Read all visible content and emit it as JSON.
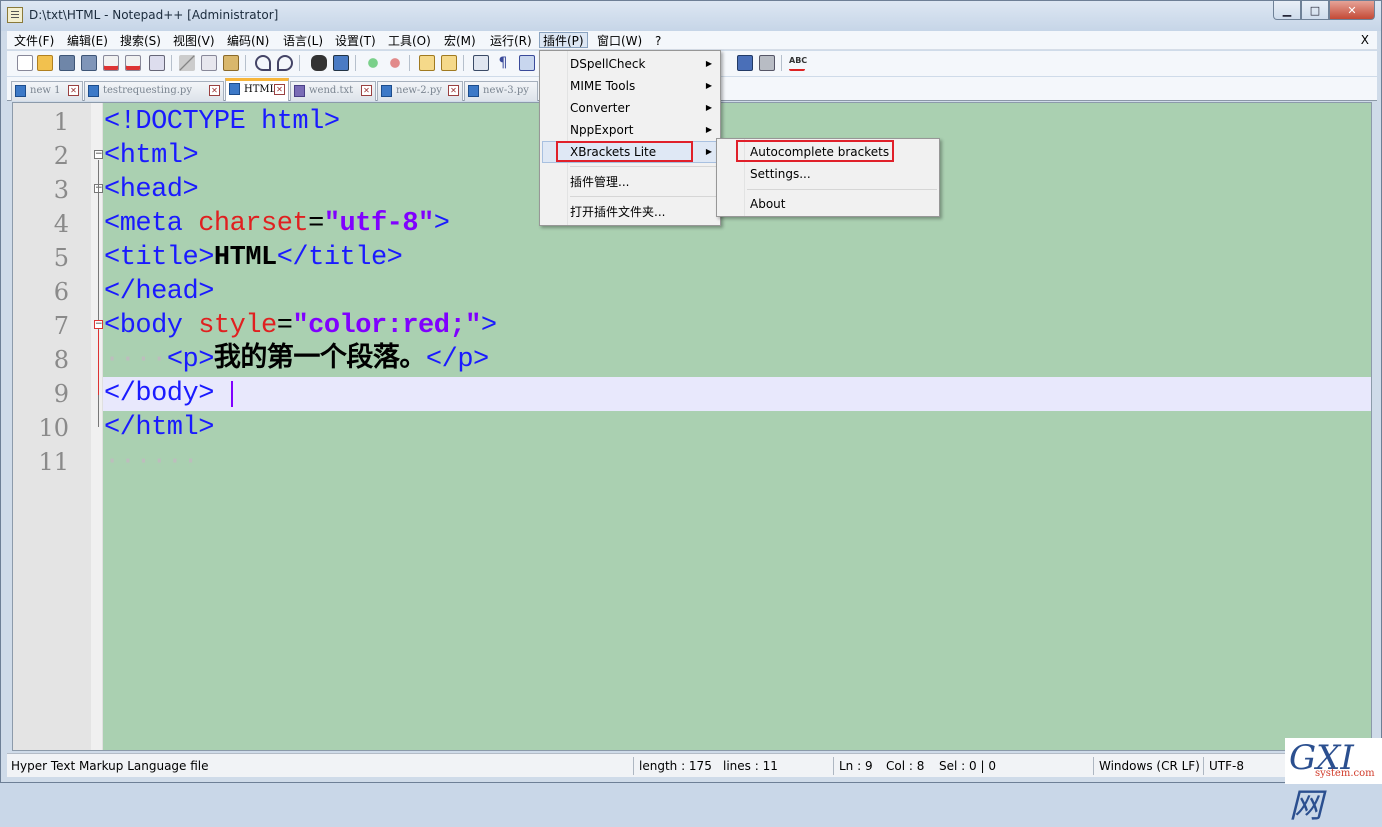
{
  "title": "D:\\txt\\HTML - Notepad++ [Administrator]",
  "menu": [
    "文件(F)",
    "编辑(E)",
    "搜索(S)",
    "视图(V)",
    "编码(N)",
    "语言(L)",
    "设置(T)",
    "工具(O)",
    "宏(M)",
    "运行(R)",
    "插件(P)",
    "窗口(W)",
    "?"
  ],
  "menu_close": "X",
  "tabs": [
    "new 1",
    "testrequesting.py",
    "HTML",
    "wend.txt",
    "new-2.py",
    "new-3.py"
  ],
  "lines": [
    {
      "n": "1",
      "parts": [
        [
          "tag",
          "<!DOCTYPE html>"
        ]
      ]
    },
    {
      "n": "2",
      "parts": [
        [
          "tag",
          "<html>"
        ]
      ]
    },
    {
      "n": "3",
      "parts": [
        [
          "tag",
          "<head>"
        ]
      ]
    },
    {
      "n": "4",
      "parts": [
        [
          "tag",
          "<meta "
        ],
        [
          "attr",
          "charset"
        ],
        [
          "plain",
          "="
        ],
        [
          "val",
          "\"utf-8\""
        ],
        [
          "tag",
          ">"
        ]
      ]
    },
    {
      "n": "5",
      "parts": [
        [
          "tag",
          "<title>"
        ],
        [
          "txt",
          "HTML"
        ],
        [
          "tag",
          "</title>"
        ]
      ]
    },
    {
      "n": "6",
      "parts": [
        [
          "tag",
          "</head>"
        ]
      ]
    },
    {
      "n": "7",
      "parts": [
        [
          "tag",
          "<body "
        ],
        [
          "attr",
          "style"
        ],
        [
          "plain",
          "="
        ],
        [
          "val",
          "\"color:red;\""
        ],
        [
          "tag",
          ">"
        ]
      ]
    },
    {
      "n": "8",
      "parts": [
        [
          "dots",
          "····"
        ],
        [
          "tag",
          "<p>"
        ],
        [
          "txt",
          "我的第一个段落。"
        ],
        [
          "tag",
          "</p>"
        ]
      ]
    },
    {
      "n": "9",
      "parts": [
        [
          "tag",
          "</body>"
        ]
      ]
    },
    {
      "n": "10",
      "parts": [
        [
          "tag",
          "</html>"
        ]
      ]
    },
    {
      "n": "11",
      "parts": [
        [
          "dots",
          "······"
        ]
      ]
    }
  ],
  "plugins_menu": {
    "items": [
      "DSpellCheck",
      "MIME Tools",
      "Converter",
      "NppExport",
      "XBrackets Lite"
    ],
    "extra": [
      "插件管理...",
      "打开插件文件夹..."
    ]
  },
  "submenu": [
    "Autocomplete brackets",
    "Settings...",
    "About"
  ],
  "status": {
    "filetype": "Hyper Text Markup Language file",
    "length": "length : 175",
    "lines": "lines : 11",
    "ln": "Ln : 9",
    "col": "Col : 8",
    "sel": "Sel : 0 | 0",
    "eol": "Windows (CR LF)",
    "encoding": "UTF-8"
  },
  "watermark": {
    "logo": "GXI网",
    "site": "system.com"
  },
  "colors": {
    "editor_bg": "#aad0b1",
    "tag": "#1a1aff",
    "attr": "#e02020",
    "value": "#8000ff",
    "highlight_box": "#e0202a"
  }
}
